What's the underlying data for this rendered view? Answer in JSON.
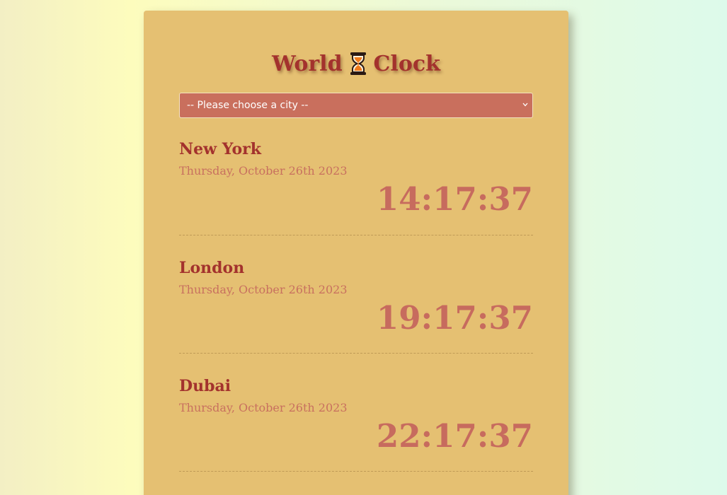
{
  "app": {
    "title_left": "World",
    "title_right": "Clock",
    "title_icon": "hourglass-icon"
  },
  "select": {
    "selected": "-- Please choose a city --"
  },
  "cities": [
    {
      "name": "New York",
      "date": "Thursday, October 26th 2023",
      "time": "14:17:37"
    },
    {
      "name": "London",
      "date": "Thursday, October 26th 2023",
      "time": "19:17:37"
    },
    {
      "name": "Dubai",
      "date": "Thursday, October 26th 2023",
      "time": "22:17:37"
    }
  ],
  "colors": {
    "card": "#e5c072",
    "title": "#a3322d",
    "select_bg": "#c96f5d",
    "time": "#c76b5e",
    "date": "#c8705f"
  }
}
